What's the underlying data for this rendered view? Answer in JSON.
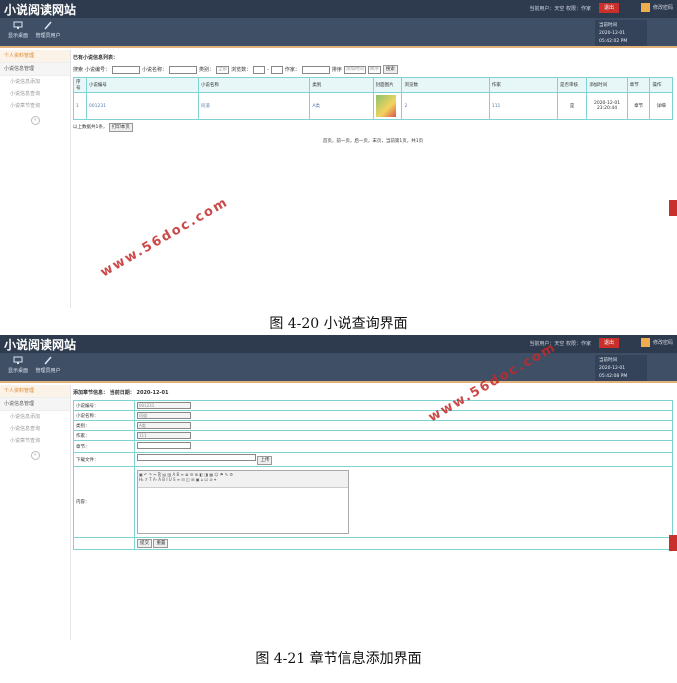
{
  "header": {
    "app_title": "小说阅读网站",
    "status_text": "当前用户：天空  权限：作家",
    "exit_label": "退出",
    "change_pw_label": "修改密码"
  },
  "toolbar": {
    "items": [
      {
        "label": "显示桌面",
        "icon": "monitor-icon"
      },
      {
        "label": "管理员用户",
        "icon": "pencil-icon"
      }
    ],
    "clock_label": "当前时间",
    "clock_top": "2020-12-01 05:42:02 PM",
    "clock_bottom": "2020-12-01 05:42:08 PM"
  },
  "sidebar": {
    "section": "个人资料管理",
    "group": "小说信息管理",
    "sub_items": [
      "小说信息添加",
      "小说信息查询",
      "小说章节查询"
    ]
  },
  "list_page": {
    "title": "已有小说信息列表：",
    "search": {
      "prefix": "搜索",
      "novel_no_label": "小说编号：",
      "novel_name_label": "小说名称：",
      "category_label": "类别：",
      "category_value": "全部",
      "views_label": "浏览数：",
      "author_label": "作家：",
      "sort_label": "排序",
      "sort_field": "添加时间",
      "sort_order": "降序",
      "search_btn": "搜索"
    },
    "columns": [
      "序号",
      "小说编号",
      "小说名称",
      "类别",
      "封面图片",
      "浏览数",
      "作家",
      "是否审核",
      "添加时间",
      "章节",
      "操作"
    ],
    "rows": [
      {
        "index": "1",
        "no": "001231",
        "name": "问道",
        "category": "A类",
        "views": "2",
        "author": "111",
        "reviewed": "是",
        "added": "2020-12-01 23:20:44",
        "chapter": "章节",
        "action": "详细"
      }
    ],
    "footer_count": "以上数据共1条，",
    "print_btn": "打印本页",
    "pager": "首页，前一页，后一页，末页，当前第1页，共1页"
  },
  "captions": {
    "fig1": "图 4-20  小说查询界面",
    "fig2": "图 4-21 章节信息添加界面"
  },
  "form_page": {
    "title": "添加章节信息：  当前日期：  2020-12-01",
    "fields": [
      {
        "label": "小说编号：",
        "value": "001231"
      },
      {
        "label": "小说名称：",
        "value": "问道"
      },
      {
        "label": "类别：",
        "value": "A类"
      },
      {
        "label": "作家：",
        "value": "111"
      },
      {
        "label": "章节：",
        "value": ""
      },
      {
        "label": "下载文件：",
        "value": ""
      }
    ],
    "upload_btn": "上传",
    "content_label": "内容：",
    "submit_btn": "提交",
    "reset_btn": "重置"
  },
  "watermark": "www.56doc.com"
}
